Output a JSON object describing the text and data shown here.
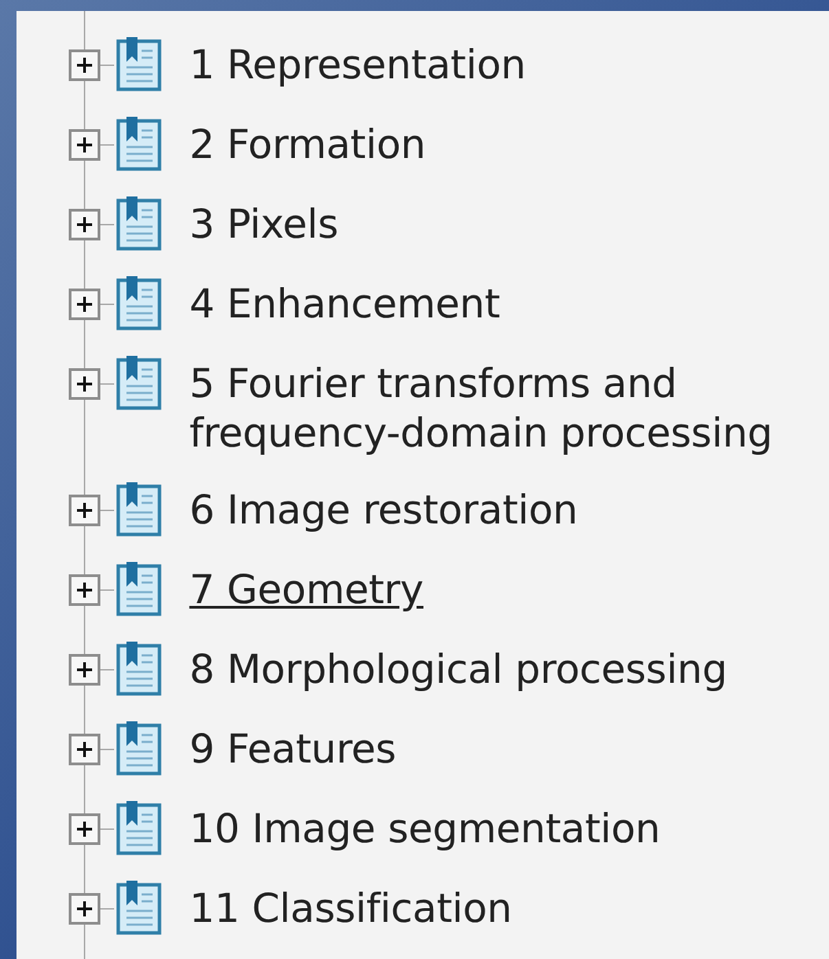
{
  "bookmarks": [
    {
      "label": "1 Representation",
      "expanded": false,
      "hovered": false
    },
    {
      "label": "2 Formation",
      "expanded": false,
      "hovered": false
    },
    {
      "label": "3 Pixels",
      "expanded": false,
      "hovered": false
    },
    {
      "label": "4 Enhancement",
      "expanded": false,
      "hovered": false
    },
    {
      "label": "5 Fourier transforms and frequency-domain processing",
      "expanded": false,
      "hovered": false
    },
    {
      "label": "6 Image restoration",
      "expanded": false,
      "hovered": false
    },
    {
      "label": "7 Geometry",
      "expanded": false,
      "hovered": true
    },
    {
      "label": "8 Morphological processing",
      "expanded": false,
      "hovered": false
    },
    {
      "label": "9 Features",
      "expanded": false,
      "hovered": false
    },
    {
      "label": "10 Image segmentation",
      "expanded": false,
      "hovered": false
    },
    {
      "label": "11 Classification",
      "expanded": false,
      "hovered": false
    }
  ]
}
